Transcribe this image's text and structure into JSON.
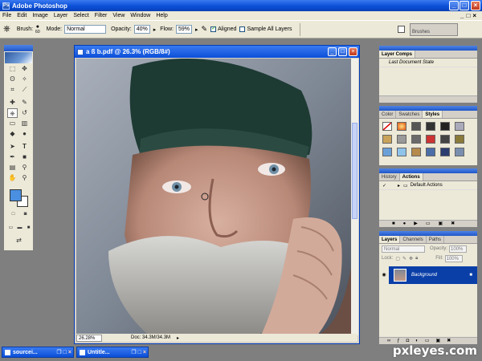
{
  "app": {
    "title": "Adobe Photoshop",
    "icon_glyph": "Ps"
  },
  "window_buttons": {
    "minimize": "_",
    "maximize": "□",
    "close": "×"
  },
  "menu": {
    "items": [
      "File",
      "Edit",
      "Image",
      "Layer",
      "Select",
      "Filter",
      "View",
      "Window",
      "Help"
    ],
    "doc_controls": [
      "_",
      "□",
      "×"
    ]
  },
  "options": {
    "brush_label": "Brush:",
    "brush_size": "60",
    "mode_label": "Mode:",
    "mode_value": "Normal",
    "opacity_label": "Opacity:",
    "opacity_value": "40%",
    "flow_label": "Flow:",
    "flow_value": "59%",
    "aligned_label": "Aligned",
    "aligned_checked": true,
    "sample_all_label": "Sample All Layers",
    "sample_all_checked": false,
    "brushes_tab": "Brushes"
  },
  "document": {
    "title": "a ß b.pdf @ 26.3% (RGB/8#)",
    "zoom": "26.28%",
    "doc_info": "Doc: 34.3M/34.3M"
  },
  "panels": {
    "layer_comps": {
      "tab": "Layer Comps",
      "row": "Last Document State"
    },
    "styles_group": {
      "tabs": [
        "Color",
        "Swatches",
        "Styles"
      ],
      "active": "Styles"
    },
    "actions_group": {
      "tabs": [
        "History",
        "Actions"
      ],
      "active": "Actions",
      "row": "Default Actions"
    },
    "layers_group": {
      "tabs": [
        "Layers",
        "Channels",
        "Paths"
      ],
      "active": "Layers",
      "blend_mode": "Normal",
      "opacity_label": "Opacity:",
      "opacity_value": "100%",
      "lock_label": "Lock:",
      "fill_label": "Fill:",
      "fill_value": "100%",
      "layer_name": "Background"
    }
  },
  "minimized": [
    {
      "title": "sourcei..."
    },
    {
      "title": "Untitle..."
    }
  ],
  "watermark": "pxleyes.com",
  "colors": {
    "foreground": "#4a8fe0",
    "background": "#ffffff",
    "title_blue": "#0b4fd8"
  }
}
